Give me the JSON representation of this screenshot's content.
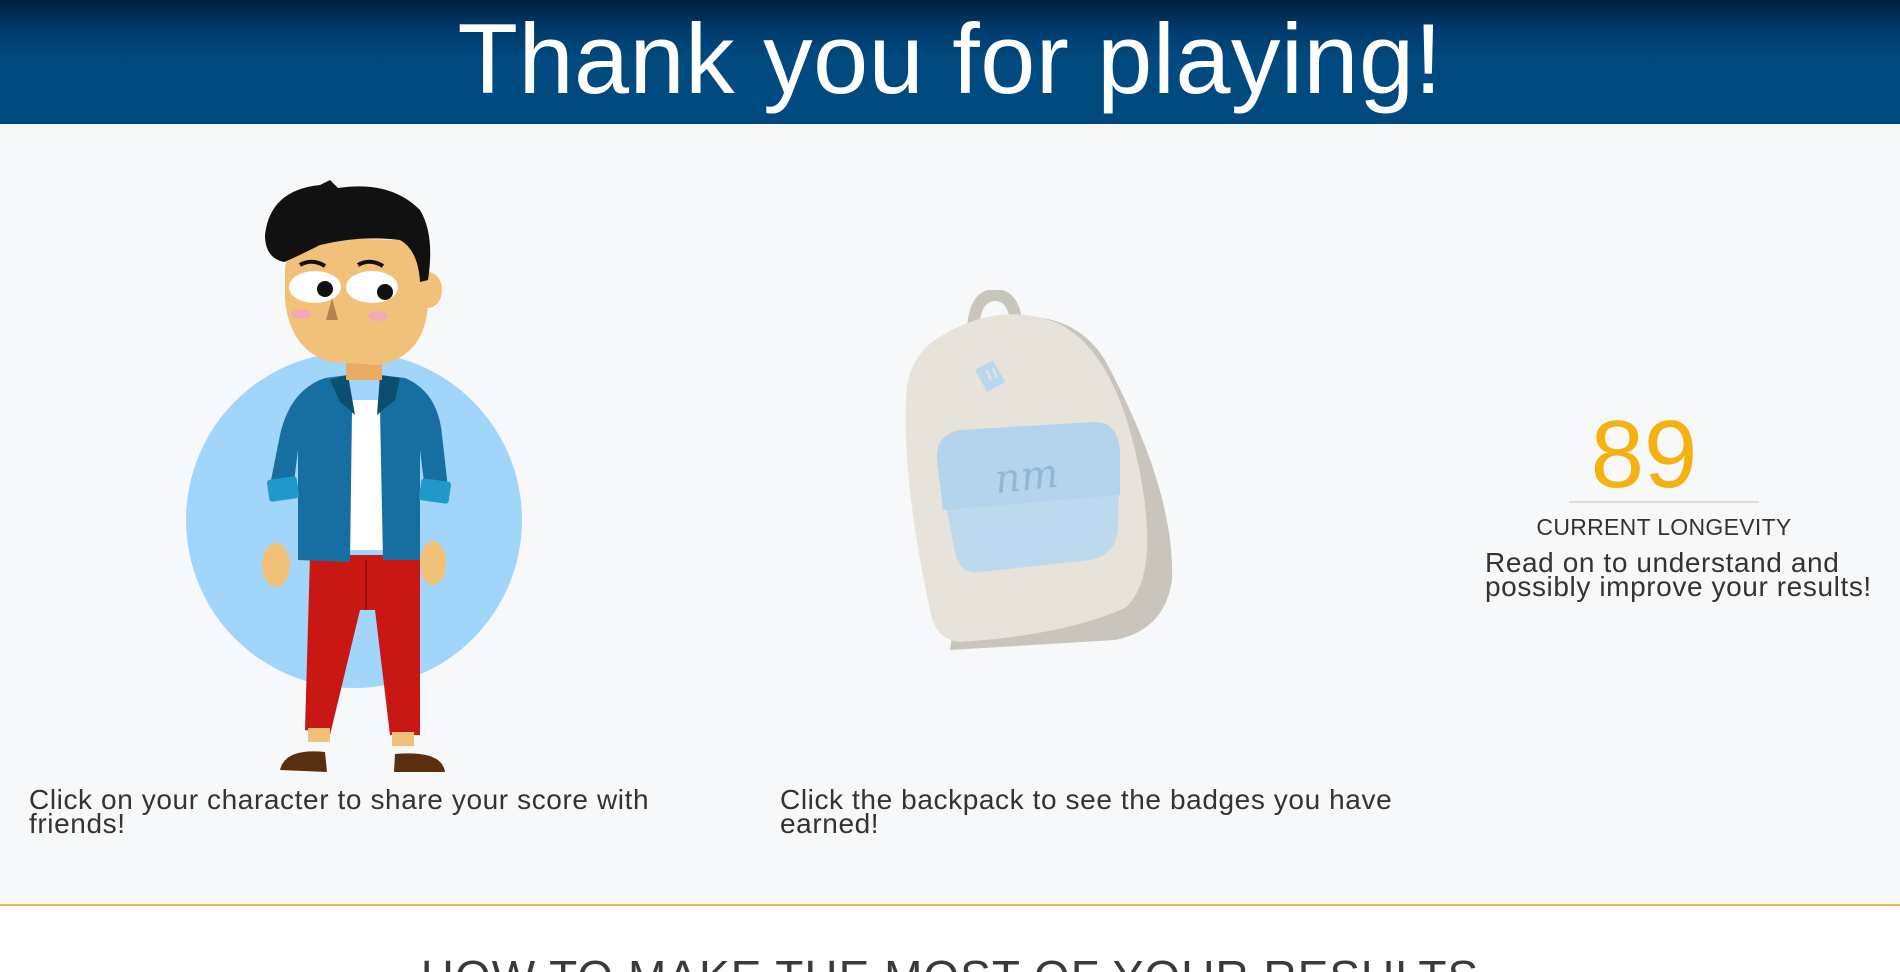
{
  "header": {
    "title": "Thank you for playing!"
  },
  "character": {
    "caption": "Click on your character to share your score with friends!"
  },
  "backpack": {
    "caption": "Click the backpack to see the badges you have earned!",
    "patch_text": "nm"
  },
  "score": {
    "value": "89",
    "label": "CURRENT LONGEVITY",
    "description": "Read on to understand and possibly improve your results!"
  },
  "footer": {
    "heading": "HOW TO MAKE THE MOST OF YOUR RESULTS"
  },
  "colors": {
    "header_bg": "#004a80",
    "accent": "#f5b731",
    "score": "#f5b10e",
    "circle": "#a1d6fa"
  }
}
